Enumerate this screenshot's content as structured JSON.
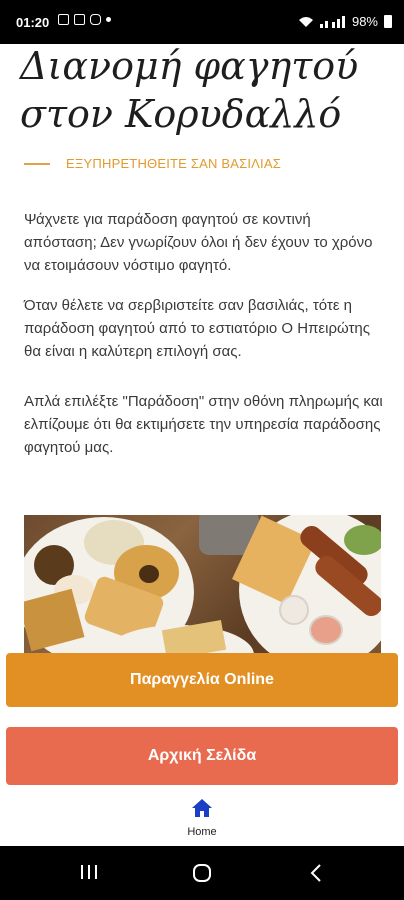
{
  "status_bar": {
    "time": "01:20",
    "battery": "98%"
  },
  "page": {
    "title": "Διανομή φαγητού στον Κορυδαλλό",
    "subtitle": "ΕΞΥΠΗΡΕΤΗΘΕΙΤΕ ΣΑΝ ΒΑΣΙΛΙΑΣ",
    "paragraphs": [
      "Ψάχνετε για παράδοση φαγητού σε κοντινή απόσταση; Δεν γνωρίζουν όλοι ή δεν έχουν το χρόνο να ετοιμάσουν νόστιμο φαγητό.",
      "Όταν θέλετε να σερβιριστείτε σαν βασιλιάς, τότε η παράδοση φαγητού από το εστιατόριο Ο Ηπειρώτης θα είναι η καλύτερη επιλογή σας.",
      "Απλά επιλέξτε \"Παράδοση\" στην οθόνη πληρωμής και ελπίζουμε ότι θα εκτιμήσετε την υπηρεσία παράδοσης φαγητού μας."
    ]
  },
  "buttons": {
    "order_online": "Παραγγελία Online",
    "home_page": "Αρχική Σελίδα"
  },
  "bottom_nav": {
    "home_label": "Home",
    "home_icon": "home-icon"
  },
  "colors": {
    "accent": "#e29a2c",
    "order_button": "#e28f24",
    "home_button": "#e86b4f",
    "nav_icon": "#1a3fc4"
  }
}
